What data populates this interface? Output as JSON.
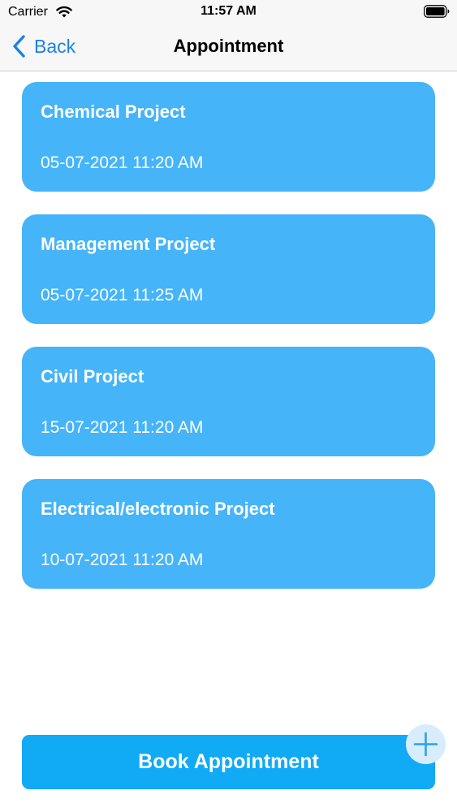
{
  "status_bar": {
    "carrier": "Carrier",
    "time": "11:57 AM",
    "wifi_icon": "wifi-icon",
    "battery_icon": "battery-icon"
  },
  "nav": {
    "back_label": "Back",
    "title": "Appointment",
    "back_icon": "chevron-left-icon"
  },
  "appointments": [
    {
      "title": "Chemical Project",
      "datetime": "05-07-2021 11:20 AM"
    },
    {
      "title": "Management Project",
      "datetime": "05-07-2021 11:25 AM"
    },
    {
      "title": "Civil Project",
      "datetime": "15-07-2021 11:20 AM"
    },
    {
      "title": "Electrical/electronic Project",
      "datetime": "10-07-2021 11:20 AM"
    }
  ],
  "footer": {
    "book_label": "Book Appointment",
    "add_icon": "plus-icon"
  },
  "colors": {
    "accent": "#1a82e6",
    "card": "#45b4f9",
    "button": "#10aaf5",
    "fab": "#d8edfb"
  }
}
